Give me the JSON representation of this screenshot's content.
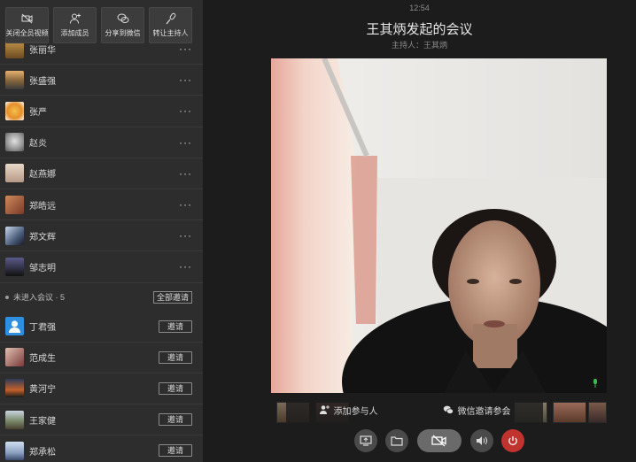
{
  "toolbar": {
    "buttons": [
      {
        "label": "关闭全员视频",
        "icon": "camera-off-icon"
      },
      {
        "label": "添加成员",
        "icon": "add-user-icon"
      },
      {
        "label": "分享到微信",
        "icon": "wechat-icon"
      },
      {
        "label": "转让主持人",
        "icon": "microphone-icon"
      }
    ]
  },
  "members": {
    "joined": [
      {
        "name": "张丽华",
        "more": "···",
        "avatar_color": "#8a6a3e"
      },
      {
        "name": "张盛强",
        "more": "···",
        "avatar_color": "#6b5a44"
      },
      {
        "name": "张严",
        "more": "···",
        "avatar_color": "#e58f2a"
      },
      {
        "name": "赵炎",
        "more": "···",
        "avatar_color": "#9b9b9b"
      },
      {
        "name": "赵燕娜",
        "more": "···",
        "avatar_color": "#b79a86"
      },
      {
        "name": "郑皓远",
        "more": "···",
        "avatar_color": "#a45a3a"
      },
      {
        "name": "郑文辉",
        "more": "···",
        "avatar_color": "#4a5d7a"
      },
      {
        "name": "邹志明",
        "more": "···",
        "avatar_color": "#2a2a3a"
      }
    ],
    "not_joined_label": "未进入会议 · 5",
    "invite_all_label": "全部邀请",
    "not_joined": [
      {
        "name": "丁君强",
        "invite": "邀请",
        "avatar_color": "#2e8ee0"
      },
      {
        "name": "范成生",
        "invite": "邀请",
        "avatar_color": "#7a3a3a"
      },
      {
        "name": "黄河宁",
        "invite": "邀请",
        "avatar_color": "#c4612a"
      },
      {
        "name": "王家健",
        "invite": "邀请",
        "avatar_color": "#7a8a6a"
      },
      {
        "name": "郑承松",
        "invite": "邀请",
        "avatar_color": "#8aa0c0"
      }
    ]
  },
  "meeting": {
    "time": "12:54",
    "title": "王其炳发起的会议",
    "host": "主持人：王其炳"
  },
  "overlay": {
    "add_participant": "添加参与人",
    "wechat_invite": "微信邀请参会"
  },
  "controls": {
    "screen_share": "screen-share-icon",
    "folder": "folder-icon",
    "camera": "camera-off-icon",
    "speaker": "speaker-icon",
    "hangup": "power-icon"
  },
  "colors": {
    "sidebar_bg": "#2d2d2d",
    "main_bg": "#1c1c1c",
    "hangup": "#c0332f"
  }
}
